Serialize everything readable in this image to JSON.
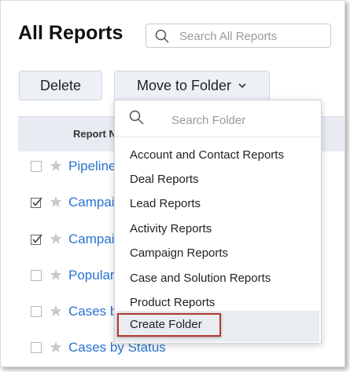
{
  "page": {
    "title": "All Reports"
  },
  "search": {
    "placeholder": "Search All Reports"
  },
  "toolbar": {
    "delete_label": "Delete",
    "move_label": "Move to Folder"
  },
  "table": {
    "header": "Report N",
    "rows": [
      {
        "name": "Pipeline",
        "checked": false
      },
      {
        "name": "Campai",
        "checked": true
      },
      {
        "name": "Campai",
        "checked": true
      },
      {
        "name": "Popular",
        "checked": false
      },
      {
        "name": "Cases b",
        "checked": false
      },
      {
        "name": "Cases by Status",
        "checked": false
      }
    ]
  },
  "dropdown": {
    "search_placeholder": "Search Folder",
    "items": [
      "Account and Contact Reports",
      "Deal Reports",
      "Lead Reports",
      "Activity Reports",
      "Campaign Reports",
      "Case and Solution Reports",
      "Product Reports"
    ],
    "create_label": "Create Folder"
  },
  "colors": {
    "link": "#2a74d0",
    "highlight_border": "#b23a2e",
    "button_bg": "#edf1f6"
  }
}
